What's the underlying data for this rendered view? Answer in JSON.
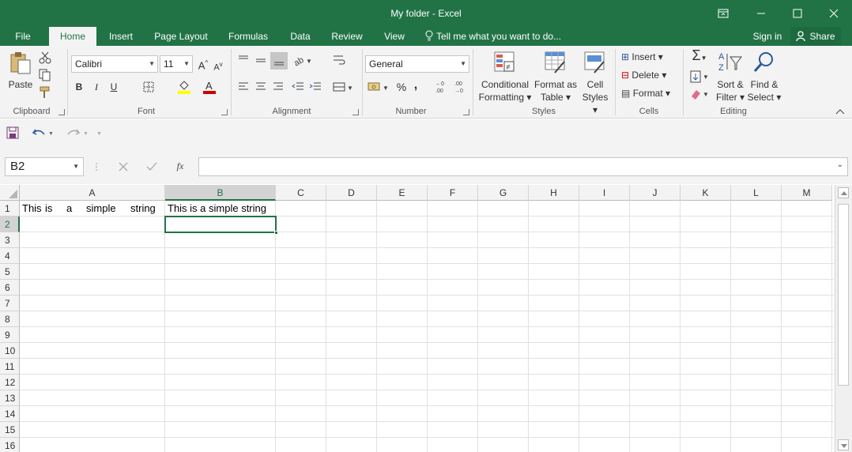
{
  "window": {
    "title": "My folder - Excel"
  },
  "tabs": [
    {
      "label": "File"
    },
    {
      "label": "Home",
      "active": true
    },
    {
      "label": "Insert"
    },
    {
      "label": "Page Layout"
    },
    {
      "label": "Formulas"
    },
    {
      "label": "Data"
    },
    {
      "label": "Review"
    },
    {
      "label": "View"
    }
  ],
  "tell_me": "Tell me what you want to do...",
  "sign_in": "Sign in",
  "share": "Share",
  "ribbon": {
    "clipboard": {
      "label": "Clipboard",
      "paste": "Paste"
    },
    "font": {
      "label": "Font",
      "family": "Calibri",
      "size": "11",
      "bold": "B",
      "italic": "I",
      "underline": "U"
    },
    "alignment": {
      "label": "Alignment"
    },
    "number": {
      "label": "Number",
      "format": "General",
      "percent": "%",
      "comma": ","
    },
    "styles": {
      "label": "Styles",
      "conditional_1": "Conditional",
      "conditional_2": "Formatting",
      "format_table_1": "Format as",
      "format_table_2": "Table",
      "cell_styles_1": "Cell",
      "cell_styles_2": "Styles"
    },
    "cells": {
      "label": "Cells",
      "insert": "Insert",
      "delete": "Delete",
      "format": "Format"
    },
    "editing": {
      "label": "Editing",
      "sort_1": "Sort &",
      "sort_2": "Filter",
      "find_1": "Find &",
      "find_2": "Select"
    }
  },
  "formula_bar": {
    "name_box": "B2",
    "fx": "fx",
    "value": ""
  },
  "grid": {
    "columns": [
      "A",
      "B",
      "C",
      "D",
      "E",
      "F",
      "G",
      "H",
      "I",
      "J",
      "K",
      "L",
      "M"
    ],
    "rows": [
      "1",
      "2",
      "3",
      "4",
      "5",
      "6",
      "7",
      "8",
      "9",
      "10",
      "11",
      "12",
      "13",
      "14",
      "15",
      "16"
    ],
    "active_cell": "B2",
    "cells": {
      "A1": [
        "This",
        "is",
        "a",
        "simple",
        "string"
      ],
      "B1": "This is a simple string"
    }
  },
  "colors": {
    "accent": "#217346",
    "ribbon_bg": "#f3f3f3"
  }
}
